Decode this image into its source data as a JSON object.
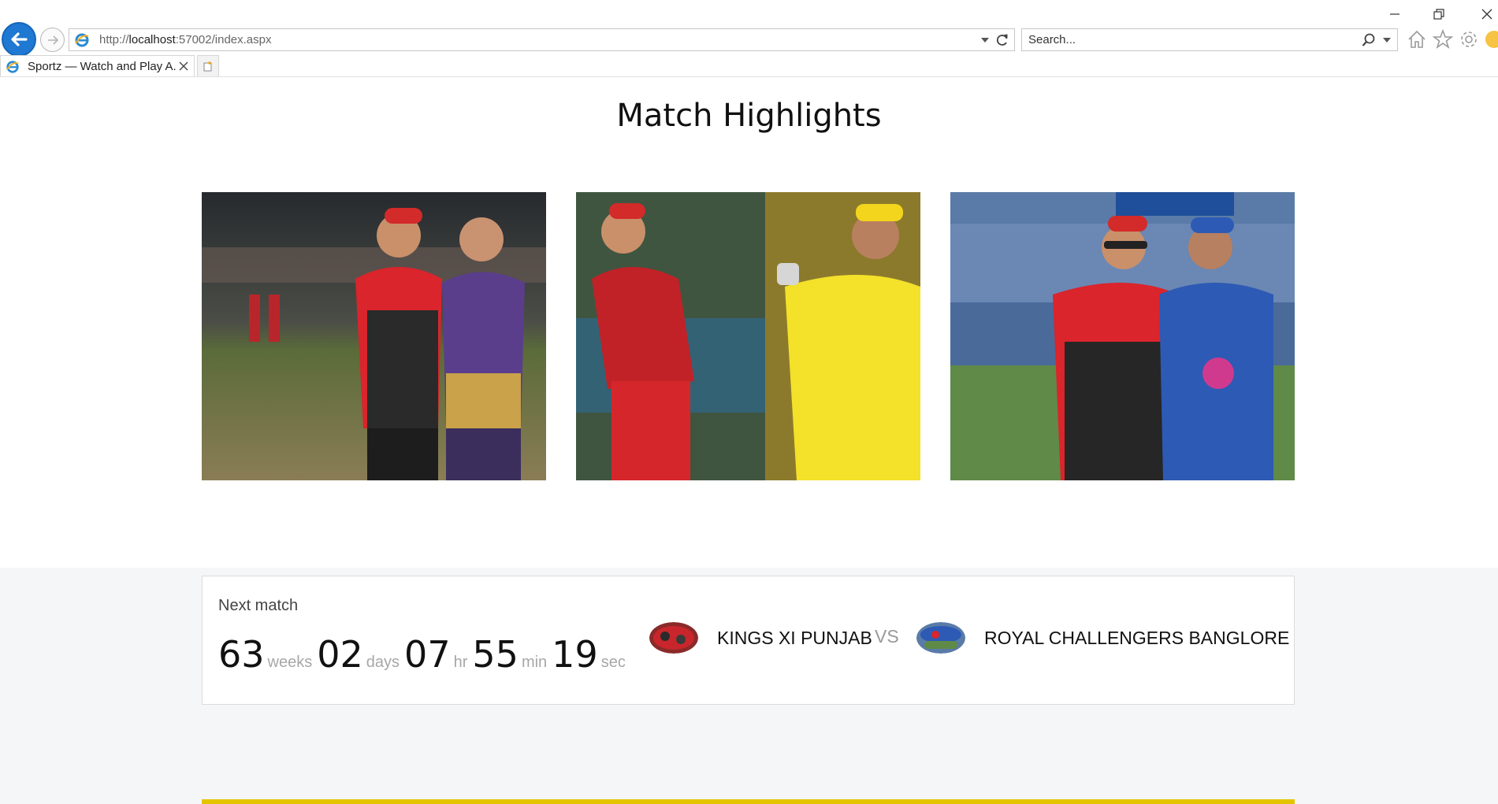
{
  "browser": {
    "url_prefix": "http://",
    "url_host": "localhost",
    "url_rest": ":57002/index.aspx",
    "search_placeholder": "Search...",
    "tab_title": "Sportz — Watch and Play A..."
  },
  "page": {
    "title": "Match Highlights",
    "highlights": [
      {
        "alt": "highlight-image-1"
      },
      {
        "alt": "highlight-image-2"
      },
      {
        "alt": "highlight-image-3"
      }
    ]
  },
  "next_match": {
    "label": "Next match",
    "countdown": [
      {
        "value": "63",
        "unit": "weeks"
      },
      {
        "value": "02",
        "unit": "days"
      },
      {
        "value": "07",
        "unit": "hr"
      },
      {
        "value": "55",
        "unit": "min"
      },
      {
        "value": "19",
        "unit": "sec"
      }
    ],
    "team_home": "KINGS XI PUNJAB",
    "vs": "VS",
    "team_away": "ROYAL CHALLENGERS BANGLORE"
  },
  "colors": {
    "accent_blue": "#1f78d1",
    "rcb_red": "#d7262d",
    "csk_yellow": "#f7e41c",
    "kkr_purple": "#5a3e8c",
    "mi_blue": "#2d5ab4",
    "band_yellow": "#e4c400"
  }
}
